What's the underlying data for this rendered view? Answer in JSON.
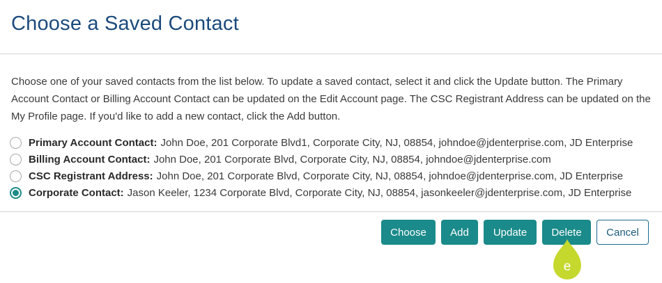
{
  "dialog": {
    "title": "Choose a Saved Contact",
    "description": "Choose one of your saved contacts from the list below. To update a saved contact, select it and click the Update button. The Primary Account Contact or Billing Account Contact can be updated on the Edit Account page. The CSC Registrant Address can be updated on the My Profile page. If you'd like to add a new contact, click the Add button."
  },
  "contacts": [
    {
      "label": "Primary Account Contact:",
      "detail": "John Doe, 201 Corporate Blvd1, Corporate City, NJ, 08854, johndoe@jdenterprise.com, JD Enterprise",
      "selected": false
    },
    {
      "label": "Billing Account Contact:",
      "detail": "John Doe, 201 Corporate Blvd, Corporate City, NJ, 08854, johndoe@jdenterprise.com",
      "selected": false
    },
    {
      "label": "CSC Registrant Address:",
      "detail": "John Doe, 201 Corporate Blvd, Corporate City, NJ, 08854, johndoe@jdenterprise.com, JD Enterprise",
      "selected": false
    },
    {
      "label": "Corporate Contact:",
      "detail": "Jason Keeler, 1234 Corporate Blvd, Corporate City, NJ, 08854, jasonkeeler@jdenterprise.com, JD Enterprise",
      "selected": true
    }
  ],
  "buttons": {
    "choose": "Choose",
    "add": "Add",
    "update": "Update",
    "delete": "Delete",
    "cancel": "Cancel"
  },
  "marker": {
    "letter": "e",
    "color": "#c5d82e"
  },
  "colors": {
    "title": "#1b4a7c",
    "accent": "#1b8a8a"
  }
}
